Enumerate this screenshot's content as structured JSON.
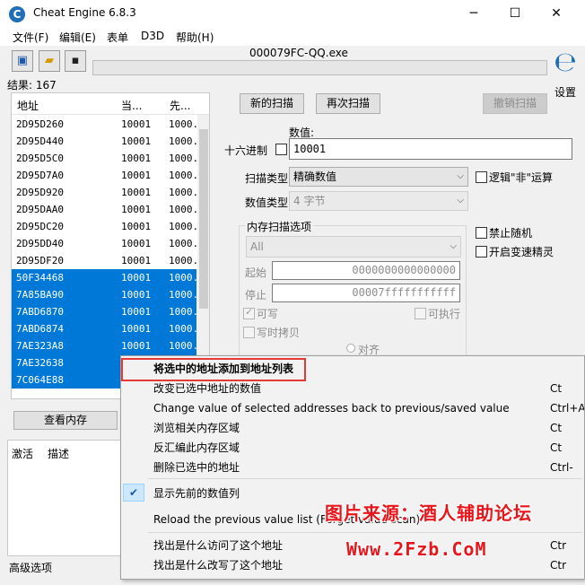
{
  "window": {
    "title": "Cheat Engine 6.8.3",
    "controls": {
      "minimize": "─",
      "maximize": "☐",
      "close": "✕"
    }
  },
  "menu": [
    "文件(F)",
    "编辑(E)",
    "表单",
    "D3D",
    "帮助(H)"
  ],
  "toolbar": {
    "process_name": "000079FC-QQ.exe",
    "settings_label": "设置"
  },
  "results": {
    "count_label": "结果: 167",
    "columns": [
      "地址",
      "当...",
      "先..."
    ],
    "rows": [
      {
        "address": "2D95D260",
        "current": "10001",
        "previous": "1000.",
        "selected": false
      },
      {
        "address": "2D95D440",
        "current": "10001",
        "previous": "1000.",
        "selected": false
      },
      {
        "address": "2D95D5C0",
        "current": "10001",
        "previous": "1000.",
        "selected": false
      },
      {
        "address": "2D95D7A0",
        "current": "10001",
        "previous": "1000.",
        "selected": false
      },
      {
        "address": "2D95D920",
        "current": "10001",
        "previous": "1000.",
        "selected": false
      },
      {
        "address": "2D95DAA0",
        "current": "10001",
        "previous": "1000.",
        "selected": false
      },
      {
        "address": "2D95DC20",
        "current": "10001",
        "previous": "1000.",
        "selected": false
      },
      {
        "address": "2D95DD40",
        "current": "10001",
        "previous": "1000.",
        "selected": false
      },
      {
        "address": "2D95DF20",
        "current": "10001",
        "previous": "1000.",
        "selected": false
      },
      {
        "address": "50F34468",
        "current": "10001",
        "previous": "1000.",
        "selected": true
      },
      {
        "address": "7A85BA90",
        "current": "10001",
        "previous": "1000.",
        "selected": true
      },
      {
        "address": "7ABD6870",
        "current": "10001",
        "previous": "1000.",
        "selected": true
      },
      {
        "address": "7ABD6874",
        "current": "10001",
        "previous": "1000.",
        "selected": true
      },
      {
        "address": "7AE323A8",
        "current": "10001",
        "previous": "1000.",
        "selected": true
      },
      {
        "address": "7AE32638",
        "current": "",
        "previous": "",
        "selected": true
      },
      {
        "address": "7C064E88",
        "current": "",
        "previous": "",
        "selected": true
      }
    ],
    "view_memory_button": "查看内存"
  },
  "bottom_list": {
    "columns": [
      "激活",
      "描述"
    ]
  },
  "advanced_options": "高级选项",
  "scan": {
    "new_scan": "新的扫描",
    "next_scan": "再次扫描",
    "undo_scan": "撤销扫描",
    "value_label": "数值:",
    "hex_label": "十六进制",
    "value": "10001",
    "scan_type_label": "扫描类型",
    "scan_type_value": "精确数值",
    "value_type_label": "数值类型",
    "value_type_value": "4 字节",
    "logic_not": "逻辑\"非\"运算",
    "memory_options_label": "内存扫描选项",
    "memory_region": "All",
    "start_label": "起始",
    "start_value": "0000000000000000",
    "stop_label": "停止",
    "stop_value": "00007fffffffffff",
    "writable": "可写",
    "executable": "可执行",
    "copy_on_write": "写时拷贝",
    "disable_random": "禁止随机",
    "speedhack": "开启变速精灵",
    "align": "对齐"
  },
  "context_menu": {
    "items": [
      {
        "label": "将选中的地址添加到地址列表",
        "shortcut": "",
        "bold": true
      },
      {
        "label": "改变已选中地址的数值",
        "shortcut": "Ct"
      },
      {
        "label": "Change value of selected addresses back to previous/saved value",
        "shortcut": "Ctrl+A"
      },
      {
        "label": "浏览相关内存区域",
        "shortcut": "Ct"
      },
      {
        "label": "反汇编此内存区域",
        "shortcut": "Ct"
      },
      {
        "label": "删除已选中的地址",
        "shortcut": "Ctrl-"
      },
      {
        "label": "显示先前的数值列",
        "shortcut": "",
        "checked": true
      },
      {
        "label": "Reload the previous value list (Forget value scan)",
        "shortcut": ""
      },
      {
        "label": "找出是什么访问了这个地址",
        "shortcut": "Ctr"
      },
      {
        "label": "找出是什么改写了这个地址",
        "shortcut": "Ctr"
      }
    ],
    "check_mark": "✔"
  },
  "watermark": {
    "line1": "图片来源：酒人辅助论坛",
    "line2": "Www.2Fzb.CoM"
  },
  "colors": {
    "selection": "#0078d7",
    "highlight_box": "#e53935",
    "watermark": "#e8151b"
  },
  "icons": [
    "cheat-engine-icon",
    "open-process-icon",
    "open-file-icon",
    "save-icon",
    "checkmark-icon"
  ]
}
